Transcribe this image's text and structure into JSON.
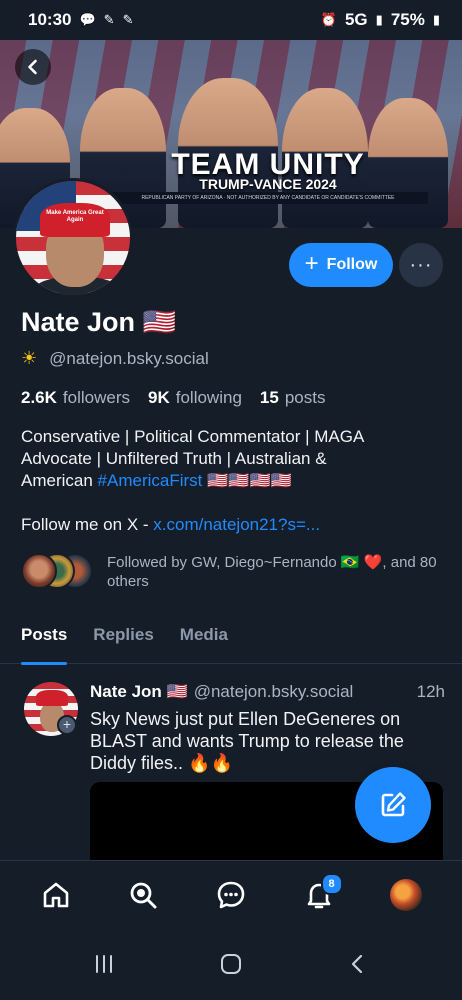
{
  "status_bar": {
    "time": "10:30",
    "network": "5G",
    "battery": "75%"
  },
  "banner": {
    "title": "TEAM UNITY",
    "subtitle": "TRUMP-VANCE 2024",
    "disclaimer": "REPUBLICAN PARTY OF ARIZONA · NOT AUTHORIZED BY ANY CANDIDATE OR CANDIDATE'S COMMITTEE"
  },
  "avatar": {
    "hat_text": "Make America Great Again"
  },
  "actions": {
    "follow_label": "Follow",
    "more_label": "···"
  },
  "profile": {
    "display_name": "Nate Jon 🇺🇸",
    "handle": "@natejon.bsky.social",
    "followers_count": "2.6K",
    "followers_label": "followers",
    "following_count": "9K",
    "following_label": "following",
    "posts_count": "15",
    "posts_label": "posts"
  },
  "bio": {
    "line1": "Conservative | Political Commentator | MAGA",
    "line2": "Advocate | Unfiltered Truth | Australian &",
    "line3_prefix": "American ",
    "hashtag": "#AmericaFirst",
    "line3_suffix": " 🇺🇸🇺🇸🇺🇸🇺🇸",
    "follow_prefix": "Follow me on X - ",
    "follow_link": "x.com/natejon21?s=..."
  },
  "followed_by": {
    "text": "Followed by GW, Diego~Fernando 🇧🇷 ❤️, and 80 others"
  },
  "tabs": [
    {
      "label": "Posts",
      "active": true
    },
    {
      "label": "Replies",
      "active": false
    },
    {
      "label": "Media",
      "active": false
    }
  ],
  "post": {
    "author": "Nate Jon 🇺🇸",
    "handle": "@natejon.bsky.social",
    "time": "12h",
    "text": "Sky News just put Ellen DeGeneres on BLAST and wants Trump to release the Diddy files.. 🔥🔥"
  },
  "bottom_nav": {
    "notification_count": "8",
    "items": [
      "home-icon",
      "search-icon",
      "chat-icon",
      "bell-icon",
      "avatar"
    ]
  },
  "colors": {
    "background": "#151d28",
    "accent": "#208bfe",
    "secondary_text": "#aab4c2"
  }
}
